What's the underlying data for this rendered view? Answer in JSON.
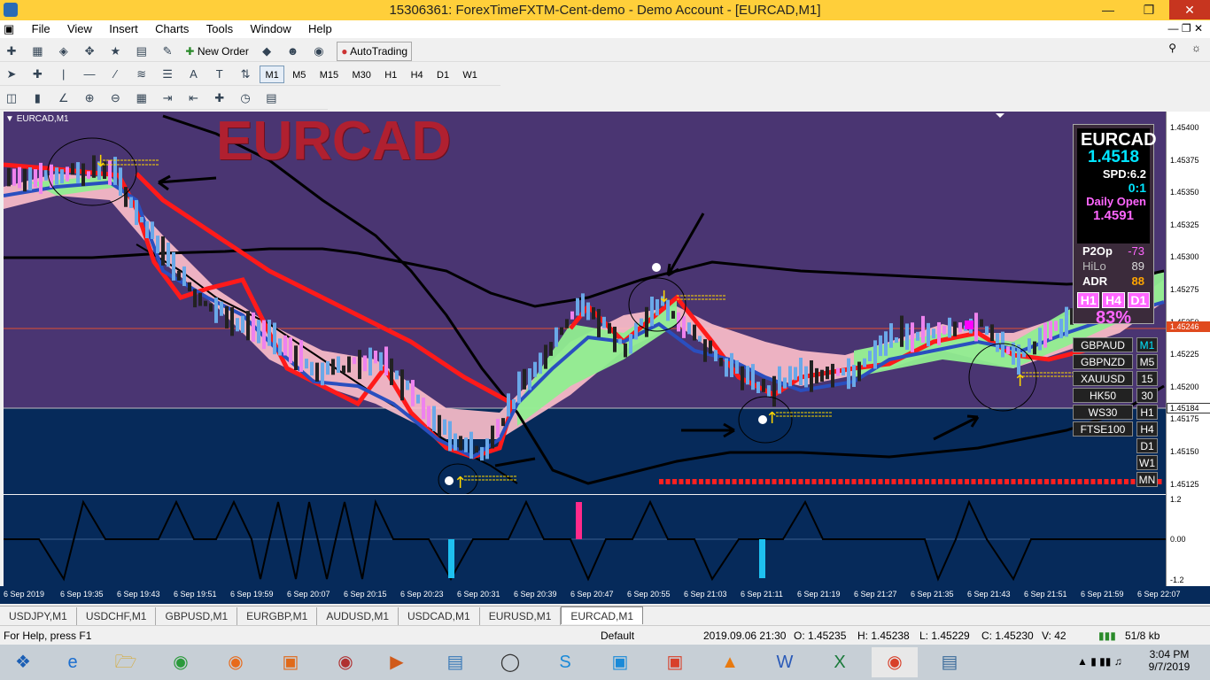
{
  "window": {
    "title": "15306361: ForexTimeFXTM-Cent-demo - Demo Account - [EURCAD,M1]"
  },
  "menu": [
    "File",
    "View",
    "Insert",
    "Charts",
    "Tools",
    "Window",
    "Help"
  ],
  "toolbar": {
    "new_order": "New Order",
    "autotrading": "AutoTrading"
  },
  "timeframes": [
    "M1",
    "M5",
    "M15",
    "M30",
    "H1",
    "H4",
    "D1",
    "W1",
    "MN"
  ],
  "chart": {
    "label": "EURCAD,M1",
    "watermark": "EURCAD",
    "price_labels": [
      "1.45400",
      "1.45375",
      "1.45350",
      "1.45325",
      "1.45300",
      "1.45275",
      "1.45250",
      "1.45225",
      "1.45200",
      "1.45175",
      "1.45150",
      "1.45125"
    ],
    "current_price": "1.45246",
    "line_price": "1.45184",
    "ind_labels": [
      "1.2",
      "0.00",
      "-1.2"
    ]
  },
  "info": {
    "symbol": "EURCAD",
    "price": "1.4518",
    "spd": "SPD:6.2",
    "ratio": "0:1",
    "daily_open_label": "Daily Open",
    "daily_open": "1.4591",
    "p2op_label": "P2Op",
    "p2op": "-73",
    "hilo_label": "HiLo",
    "hilo": "89",
    "adr_label": "ADR",
    "adr": "88",
    "tf": [
      "H1",
      "H4",
      "D1"
    ],
    "pct": "83%"
  },
  "symbols": [
    "GBPAUD",
    "GBPNZD",
    "XAUUSD",
    "HK50",
    "WS30",
    "FTSE100"
  ],
  "side_tf": [
    "M1",
    "M5",
    "15",
    "30",
    "H1",
    "H4",
    "D1",
    "W1",
    "MN"
  ],
  "time_labels": [
    "6 Sep 2019",
    "6 Sep 19:35",
    "6 Sep 19:43",
    "6 Sep 19:51",
    "6 Sep 19:59",
    "6 Sep 20:07",
    "6 Sep 20:15",
    "6 Sep 20:23",
    "6 Sep 20:31",
    "6 Sep 20:39",
    "6 Sep 20:47",
    "6 Sep 20:55",
    "6 Sep 21:03",
    "6 Sep 21:11",
    "6 Sep 21:19",
    "6 Sep 21:27",
    "6 Sep 21:35",
    "6 Sep 21:43",
    "6 Sep 21:51",
    "6 Sep 21:59",
    "6 Sep 22:07"
  ],
  "tabs": [
    "USDJPY,M1",
    "USDCHF,M1",
    "GBPUSD,M1",
    "EURGBP,M1",
    "AUDUSD,M1",
    "USDCAD,M1",
    "EURUSD,M1",
    "EURCAD,M1"
  ],
  "status": {
    "help": "For Help, press F1",
    "profile": "Default",
    "datetime": "2019.09.06 21:30",
    "open": "O: 1.45235",
    "high": "H: 1.45238",
    "low": "L: 1.45229",
    "close": "C: 1.45230",
    "volume": "V: 42",
    "traffic": "51/8 kb"
  },
  "clock": {
    "time": "3:04 PM",
    "date": "9/7/2019"
  }
}
